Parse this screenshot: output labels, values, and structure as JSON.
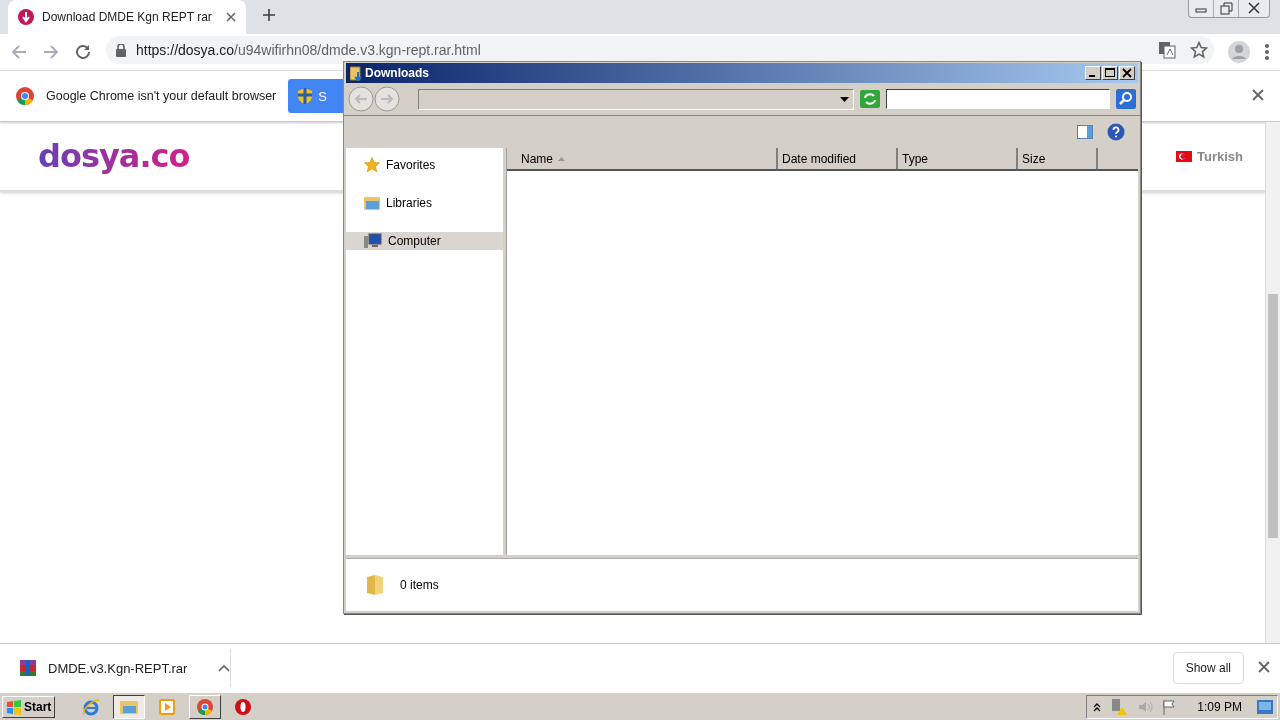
{
  "browser": {
    "tab": {
      "title": "Download DMDE Kgn REPT rar"
    },
    "url": {
      "host": "https://dosya.co",
      "path": "/u94wifirhn08/dmde.v3.kgn-rept.rar.html"
    },
    "infobar": {
      "message": "Google Chrome isn't your default browser",
      "button": "S"
    },
    "page": {
      "logo": "dosya.co",
      "language": "Turkish"
    },
    "downloads_shelf": {
      "file": "DMDE.v3.Kgn-REPT.rar",
      "show_all": "Show all"
    }
  },
  "dialog": {
    "title": "Downloads",
    "nav_items": [
      {
        "label": "Favorites",
        "kind": "star",
        "selected": false
      },
      {
        "label": "Libraries",
        "kind": "library",
        "selected": false
      },
      {
        "label": "Computer",
        "kind": "computer",
        "selected": true
      }
    ],
    "columns": [
      {
        "label": "Name",
        "sorted": true
      },
      {
        "label": "Date modified",
        "sorted": false
      },
      {
        "label": "Type",
        "sorted": false
      },
      {
        "label": "Size",
        "sorted": false
      }
    ],
    "status": "0 items"
  },
  "taskbar": {
    "start": "Start",
    "clock": "1:09 PM"
  }
}
